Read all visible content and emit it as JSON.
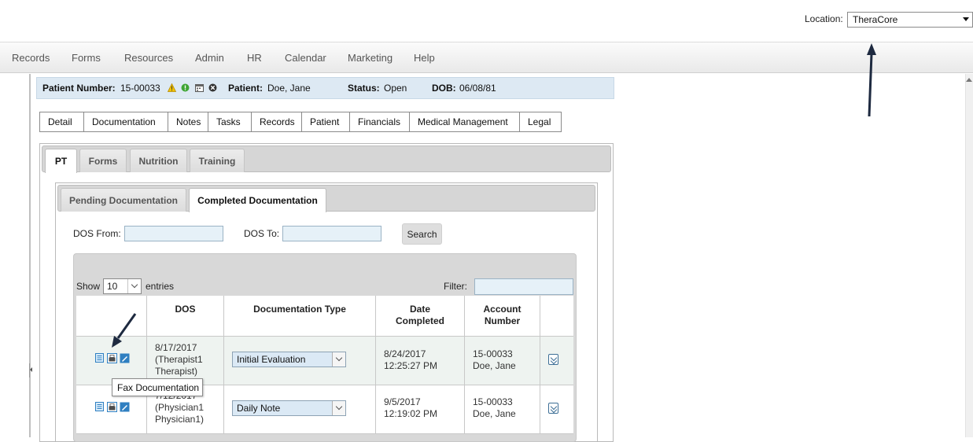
{
  "location": {
    "label": "Location:",
    "value": "TheraCore"
  },
  "menu": [
    "Records",
    "Forms",
    "Resources",
    "Admin",
    "HR",
    "Calendar",
    "Marketing",
    "Help"
  ],
  "patient": {
    "number_label": "Patient Number:",
    "number": "15-00033",
    "name_label": "Patient:",
    "name": "Doe, Jane",
    "status_label": "Status:",
    "status": "Open",
    "dob_label": "DOB:",
    "dob": "06/08/81"
  },
  "main_tabs": [
    "Detail",
    "Documentation",
    "Notes",
    "Tasks",
    "Records",
    "Patient",
    "Financials",
    "Medical Management",
    "Legal"
  ],
  "discipline_tabs": [
    "PT",
    "Forms",
    "Nutrition",
    "Training"
  ],
  "doc_tabs": [
    "Pending Documentation",
    "Completed Documentation"
  ],
  "filters": {
    "dos_from_label": "DOS From:",
    "dos_to_label": "DOS To:",
    "search_label": "Search"
  },
  "table": {
    "show_label": "Show",
    "entries_value": "10",
    "entries_label": "entries",
    "filter_label": "Filter:",
    "headers": {
      "dos": "DOS",
      "doc_type": "Documentation Type",
      "date_completed_1": "Date",
      "date_completed_2": "Completed",
      "account_1": "Account",
      "account_2": "Number"
    },
    "rows": [
      {
        "dos": "8/17/2017",
        "dos_line2": "(Therapist1",
        "dos_line3": "Therapist)",
        "doc_type": "Initial Evaluation",
        "completed_date": "8/24/2017",
        "completed_time": "12:25:27 PM",
        "account": "15-00033",
        "account_name": "Doe, Jane"
      },
      {
        "dos": "7/12/2017",
        "dos_line2": "(Physician1",
        "dos_line3": "Physician1)",
        "doc_type": "Daily Note",
        "completed_date": "9/5/2017",
        "completed_time": "12:19:02 PM",
        "account": "15-00033",
        "account_name": "Doe, Jane"
      }
    ]
  },
  "tooltip": "Fax Documentation",
  "colors": {
    "patient_bar_bg": "#dde9f3",
    "input_bg": "#e6f1f8",
    "icon_blue": "#2f7fc1",
    "annotation_arrow": "#1e2a40"
  }
}
